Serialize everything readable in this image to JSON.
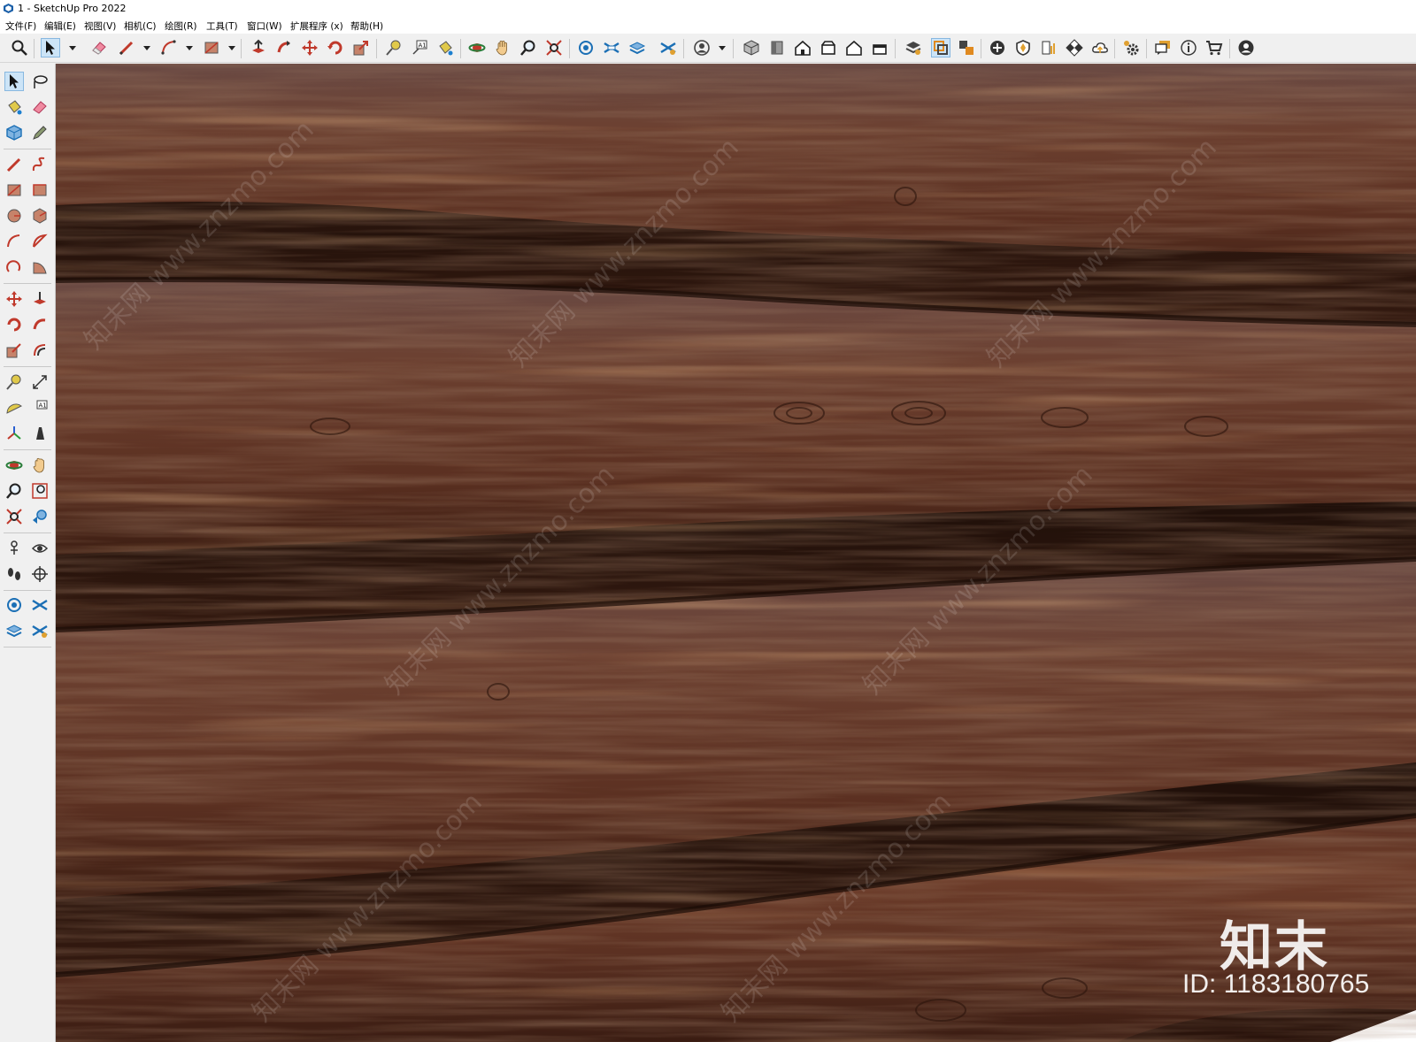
{
  "window": {
    "title": "1 - SketchUp Pro 2022"
  },
  "menu": {
    "file": "文件(F)",
    "edit": "编辑(E)",
    "view": "视图(V)",
    "camera": "相机(C)",
    "draw": "绘图(R)",
    "tools": "工具(T)",
    "window": "窗口(W)",
    "extensions": "扩展程序 (x)",
    "help": "帮助(H)"
  },
  "viewport": {
    "material": "wood-log-wall-texture",
    "watermark_brand": "知末",
    "watermark_id": "ID: 1183180765",
    "watermark_repeat": "知末网 www.znzmo.com"
  },
  "colors": {
    "accent": "#cce4f7",
    "wood_dark": "#3a1d12",
    "wood_mid": "#6b3a24",
    "wood_light": "#8a5a3e"
  }
}
